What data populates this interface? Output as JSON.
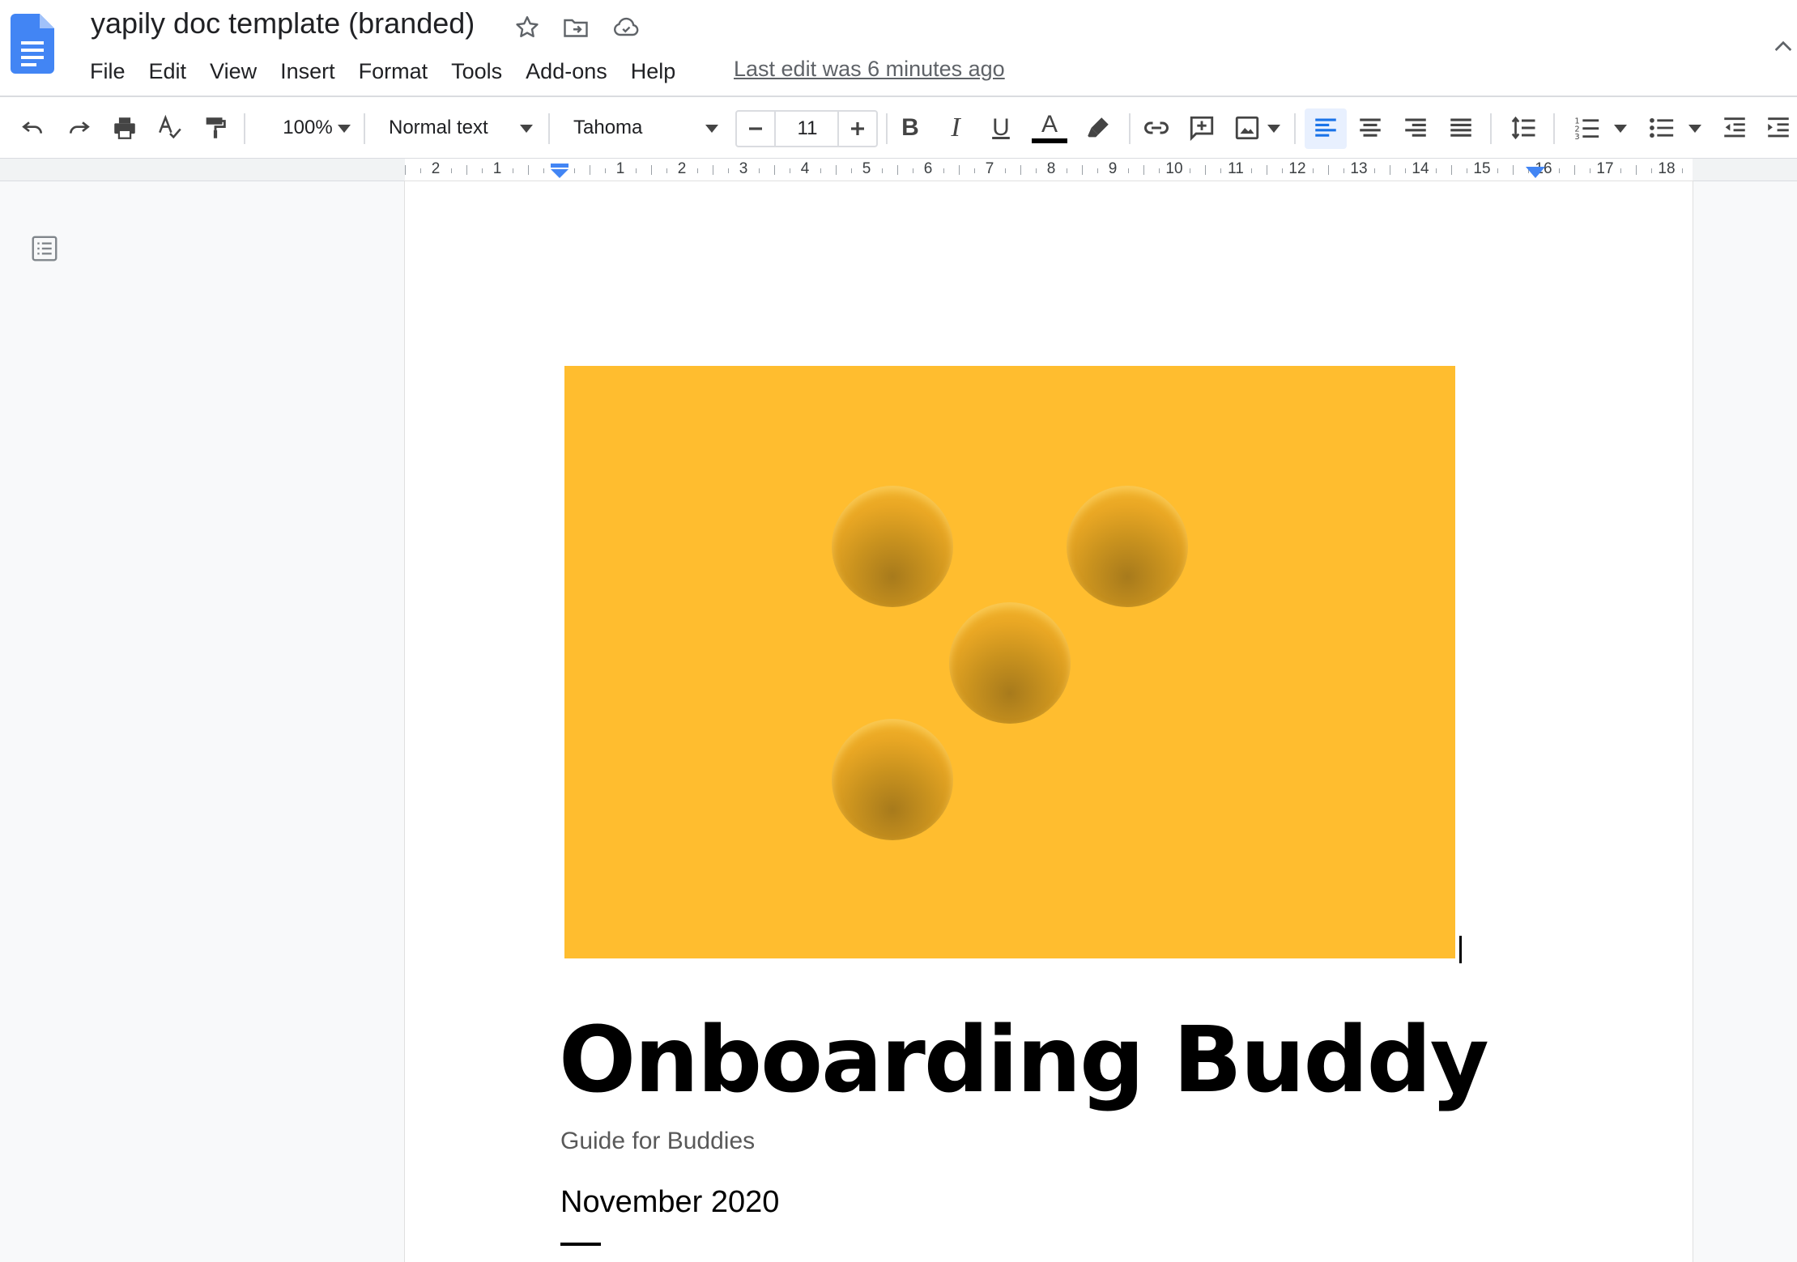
{
  "app": {
    "title": "yapily doc template (branded)",
    "menu": [
      "File",
      "Edit",
      "View",
      "Insert",
      "Format",
      "Tools",
      "Add-ons",
      "Help"
    ],
    "last_edit": "Last edit was 6 minutes ago"
  },
  "toolbar": {
    "zoom": "100%",
    "style": "Normal text",
    "font": "Tahoma",
    "font_size": "11",
    "text_color": "#000000",
    "accent": "#1a73e8"
  },
  "ruler": {
    "labels": [
      "2",
      "1",
      "1",
      "2",
      "3",
      "4",
      "5",
      "6",
      "7",
      "8",
      "9",
      "10",
      "11",
      "12",
      "13",
      "14",
      "15",
      "16",
      "17",
      "18"
    ]
  },
  "document": {
    "hero_color": "#ffbd2f",
    "heading": "Onboarding Buddy",
    "subtitle": "Guide for Buddies",
    "date": "November 2020"
  }
}
